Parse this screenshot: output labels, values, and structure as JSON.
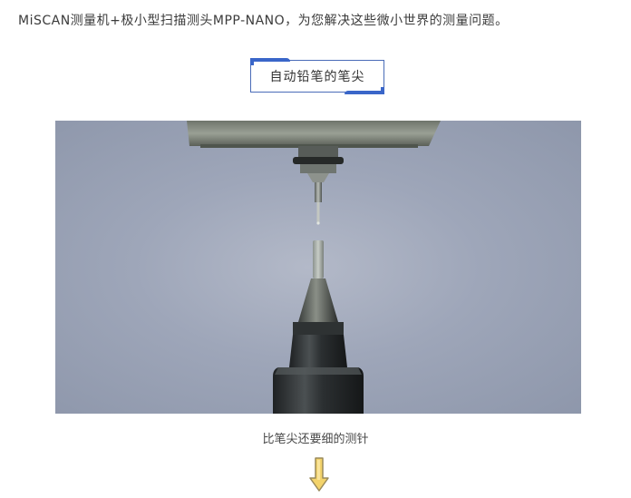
{
  "intro": {
    "text": "MiSCAN测量机+极小型扫描测头MPP-NANO，为您解决这些微小世界的测量问题。"
  },
  "section": {
    "title": "自动铅笔的笔尖"
  },
  "photo": {
    "caption": "比笔尖还要细的测针"
  },
  "icons": {
    "arrow": "down-arrow-icon"
  },
  "colors": {
    "accent": "#3a66c9",
    "arrow_fill": "#f3d36b",
    "arrow_stroke": "#9a8a5a"
  }
}
